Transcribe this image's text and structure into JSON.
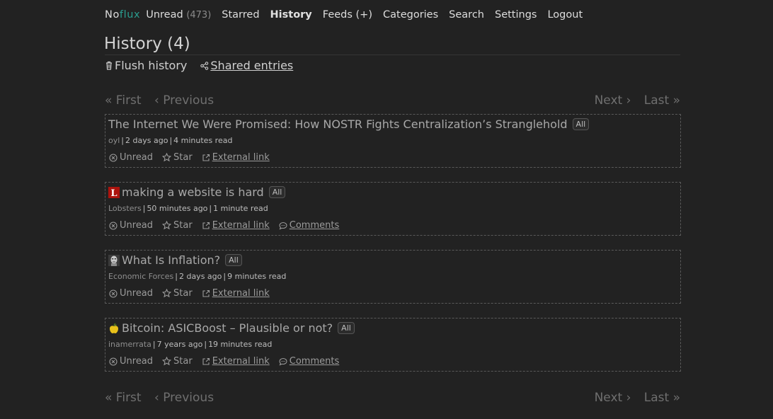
{
  "app": {
    "logo_prefix": "No",
    "logo_suffix": "flux"
  },
  "nav": {
    "unread_label": "Unread",
    "unread_count": "(473)",
    "starred_label": "Starred",
    "history_label": "History",
    "feeds_label": "Feeds (+)",
    "categories_label": "Categories",
    "search_label": "Search",
    "settings_label": "Settings",
    "logout_label": "Logout"
  },
  "page": {
    "title": "History (4)",
    "flush_label": "Flush history",
    "shared_label": "Shared entries"
  },
  "pagination": {
    "first": "« First",
    "previous": "‹ Previous",
    "next": "Next ›",
    "last": "Last »"
  },
  "entries": [
    {
      "title": "The Internet We Were Promised: How NOSTR Fights Centralization’s Stranglehold",
      "category": "All",
      "feed": "oyl",
      "date": "2 days ago",
      "reading_time": "4 minutes read",
      "unread_label": "Unread",
      "star_label": "Star",
      "external_label": "External link"
    },
    {
      "title": "making a website is hard",
      "category": "All",
      "feed": "Lobsters",
      "date": "50 minutes ago",
      "reading_time": "1 minute read",
      "unread_label": "Unread",
      "star_label": "Star",
      "external_label": "External link",
      "comments_label": "Comments",
      "favicon": "L"
    },
    {
      "title": "What Is Inflation?",
      "category": "All",
      "feed": "Economic Forces",
      "date": "2 days ago",
      "reading_time": "9 minutes read",
      "unread_label": "Unread",
      "star_label": "Star",
      "external_label": "External link"
    },
    {
      "title": "Bitcoin: ASICBoost – Plausible or not?",
      "category": "All",
      "feed": "inamerrata",
      "date": "7 years ago",
      "reading_time": "19 minutes read",
      "unread_label": "Unread",
      "star_label": "Star",
      "external_label": "External link",
      "comments_label": "Comments"
    }
  ],
  "icons": {
    "trash": "trash-icon",
    "share": "share-icon",
    "unread": "circle-x-icon",
    "star": "star-icon",
    "external": "external-link-icon",
    "comments": "comment-icon"
  },
  "colors": {
    "background": "#222222",
    "accent": "#2a9d8f",
    "lobsters": "#ac130d"
  }
}
